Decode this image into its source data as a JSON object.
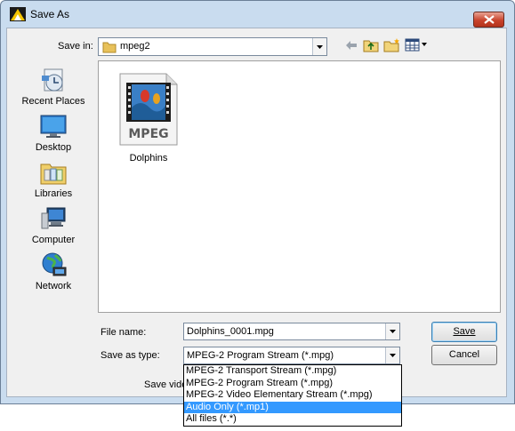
{
  "window": {
    "title": "Save As"
  },
  "save_in": {
    "label": "Save in:",
    "value": "mpeg2"
  },
  "places": [
    {
      "label": "Recent Places",
      "icon": "recent-places-icon"
    },
    {
      "label": "Desktop",
      "icon": "desktop-icon"
    },
    {
      "label": "Libraries",
      "icon": "libraries-icon"
    },
    {
      "label": "Computer",
      "icon": "computer-icon"
    },
    {
      "label": "Network",
      "icon": "network-icon"
    }
  ],
  "files": [
    {
      "name": "Dolphins",
      "badge": "MPEG"
    }
  ],
  "file_name": {
    "label": "File name:",
    "value": "Dolphins_0001.mpg"
  },
  "save_as_type": {
    "label": "Save as type:",
    "value": "MPEG-2 Program Stream (*.mpg)",
    "options": [
      "MPEG-2 Transport Stream (*.mpg)",
      "MPEG-2 Program Stream (*.mpg)",
      "MPEG-2 Video Elementary Stream (*.mpg)",
      "Audio Only (*.mp1)",
      "All files (*.*)"
    ],
    "highlighted_index": 3
  },
  "partial_label": "Save vide",
  "buttons": {
    "save": "Save",
    "cancel": "Cancel"
  },
  "colors": {
    "selection": "#3399ff",
    "close_button": "#c9442d"
  }
}
